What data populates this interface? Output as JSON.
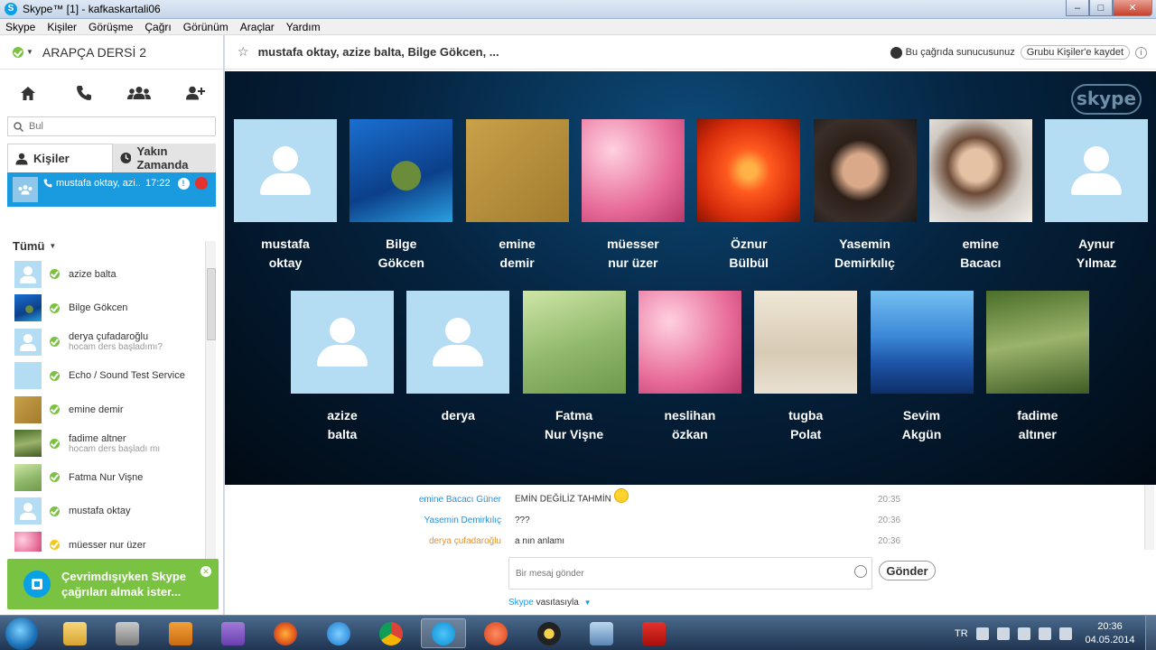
{
  "window": {
    "title": "Skype™ [1] - kafkaskartali06",
    "buttons": {
      "minimize": "–",
      "maximize": "□",
      "close": "✕"
    }
  },
  "menu": [
    "Skype",
    "Kişiler",
    "Görüşme",
    "Çağrı",
    "Görünüm",
    "Araçlar",
    "Yardım"
  ],
  "profile": {
    "name": "ARAPÇA DERSİ 2"
  },
  "search": {
    "placeholder": "Bul"
  },
  "tabs": {
    "contacts": "Kişiler",
    "recent": "Yakın Zamanda"
  },
  "active_call": {
    "name": "mustafa oktay, azi...",
    "time": "17:22",
    "badge": "!"
  },
  "contact_group": "Tümü",
  "contacts": [
    {
      "name": "azize balta",
      "mood": "",
      "status": "online",
      "avatar": "placeholder"
    },
    {
      "name": "Bilge Gökcen",
      "mood": "",
      "status": "online",
      "avatar": "turtle"
    },
    {
      "name": "derya çufadaroğlu",
      "mood": "hocam ders başladımı?",
      "status": "online",
      "avatar": "placeholder"
    },
    {
      "name": "Echo / Sound Test Service",
      "mood": "",
      "status": "online",
      "avatar": "echo"
    },
    {
      "name": "emine demir",
      "mood": "",
      "status": "online",
      "avatar": "gold"
    },
    {
      "name": "fadime altner",
      "mood": "hocam ders başladı mı",
      "status": "online",
      "avatar": "boy"
    },
    {
      "name": "Fatma Nur Vişne",
      "mood": "",
      "status": "online",
      "avatar": "birds"
    },
    {
      "name": "mustafa oktay",
      "mood": "",
      "status": "online",
      "avatar": "placeholder"
    },
    {
      "name": "müesser nur üzer",
      "mood": "",
      "status": "away",
      "avatar": "pink"
    }
  ],
  "promo": {
    "line1": "Çevrimdışıyken Skype",
    "line2": "çağrıları almak ister..."
  },
  "call_header": {
    "title": "mustafa oktay, azize balta, Bilge Gökcen, ...",
    "host_text": "Bu çağrıda sunucusunuz",
    "save_button": "Grubu Kişiler'e kaydet",
    "info": "i"
  },
  "stage": {
    "logo": "skype"
  },
  "participants": [
    {
      "line1": "mustafa",
      "line2": "oktay",
      "avatar": "placeholder"
    },
    {
      "line1": "Bilge",
      "line2": "Gökcen",
      "avatar": "turtle"
    },
    {
      "line1": "emine",
      "line2": "demir",
      "avatar": "gold"
    },
    {
      "line1": "müesser",
      "line2": "nur üzer",
      "avatar": "pink"
    },
    {
      "line1": "Öznur",
      "line2": "Bülbül",
      "avatar": "flower"
    },
    {
      "line1": "Yasemin",
      "line2": "Demirkılıç",
      "avatar": "baby"
    },
    {
      "line1": "emine",
      "line2": "Bacacı",
      "avatar": "girl"
    },
    {
      "line1": "Aynur",
      "line2": "Yılmaz",
      "avatar": "placeholder"
    },
    {
      "line1": "azize",
      "line2": "balta",
      "avatar": "placeholder"
    },
    {
      "line1": "derya",
      "line2": "",
      "avatar": "placeholder"
    },
    {
      "line1": "Fatma",
      "line2": "Nur Vişne",
      "avatar": "birds"
    },
    {
      "line1": "neslihan",
      "line2": "özkan",
      "avatar": "pink"
    },
    {
      "line1": "tugba",
      "line2": "Polat",
      "avatar": "infant"
    },
    {
      "line1": "Sevim",
      "line2": "Akgün",
      "avatar": "mountains"
    },
    {
      "line1": "fadime",
      "line2": "altıner",
      "avatar": "boy"
    }
  ],
  "messages": [
    {
      "sender": "emine Bacacı Güner",
      "text": "EMİN DEĞİLİZ TAHMİN",
      "time": "20:35",
      "color": "#2a8fd6",
      "smiley": true
    },
    {
      "sender": "Yasemin Demirkılıç",
      "text": "???",
      "time": "20:36",
      "color": "#2a8fd6",
      "smiley": false
    },
    {
      "sender": "derya çufadaroğlu",
      "text": "a nın anlamı",
      "time": "20:36",
      "color": "#e8912a",
      "smiley": false
    }
  ],
  "composer": {
    "placeholder": "Bir mesaj gönder",
    "send_button": "Gönder",
    "via_link": "Skype",
    "via_text": "vasıtasıyla"
  },
  "taskbar": {
    "lang": "TR",
    "time": "20:36",
    "date": "04.05.2014",
    "apps": [
      "explorer",
      "winamp-like",
      "media-player",
      "visual-studio",
      "firefox",
      "internet-explorer",
      "chrome",
      "skype",
      "ccleaner",
      "winamp",
      "virtual-pc",
      "acrobat"
    ]
  }
}
